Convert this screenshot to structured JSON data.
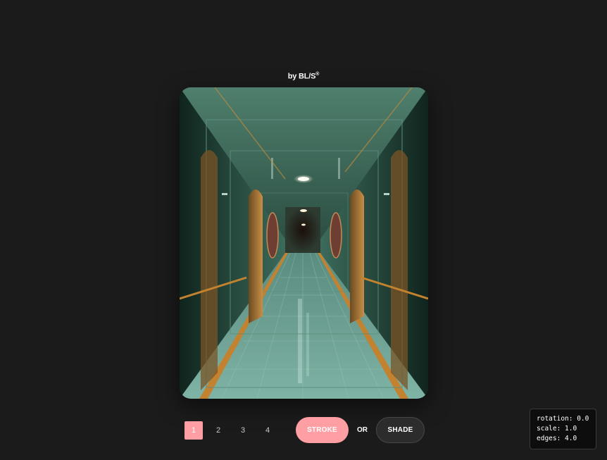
{
  "header": {
    "credit": "by BL/S",
    "credit_mark": "®"
  },
  "pager": {
    "pages": [
      "1",
      "2",
      "3",
      "4"
    ],
    "active_index": 0
  },
  "modes": {
    "stroke_label": "STROKE",
    "or_label": "OR",
    "shade_label": "SHADE",
    "active": "STROKE"
  },
  "debug": {
    "rotation": "rotation: 0.0",
    "scale": "scale: 1.0",
    "edges": "edges: 4.0"
  },
  "colors": {
    "background": "#1b1b1b",
    "accent": "#ff9fa3",
    "button_dark": "#2c2c2c"
  }
}
